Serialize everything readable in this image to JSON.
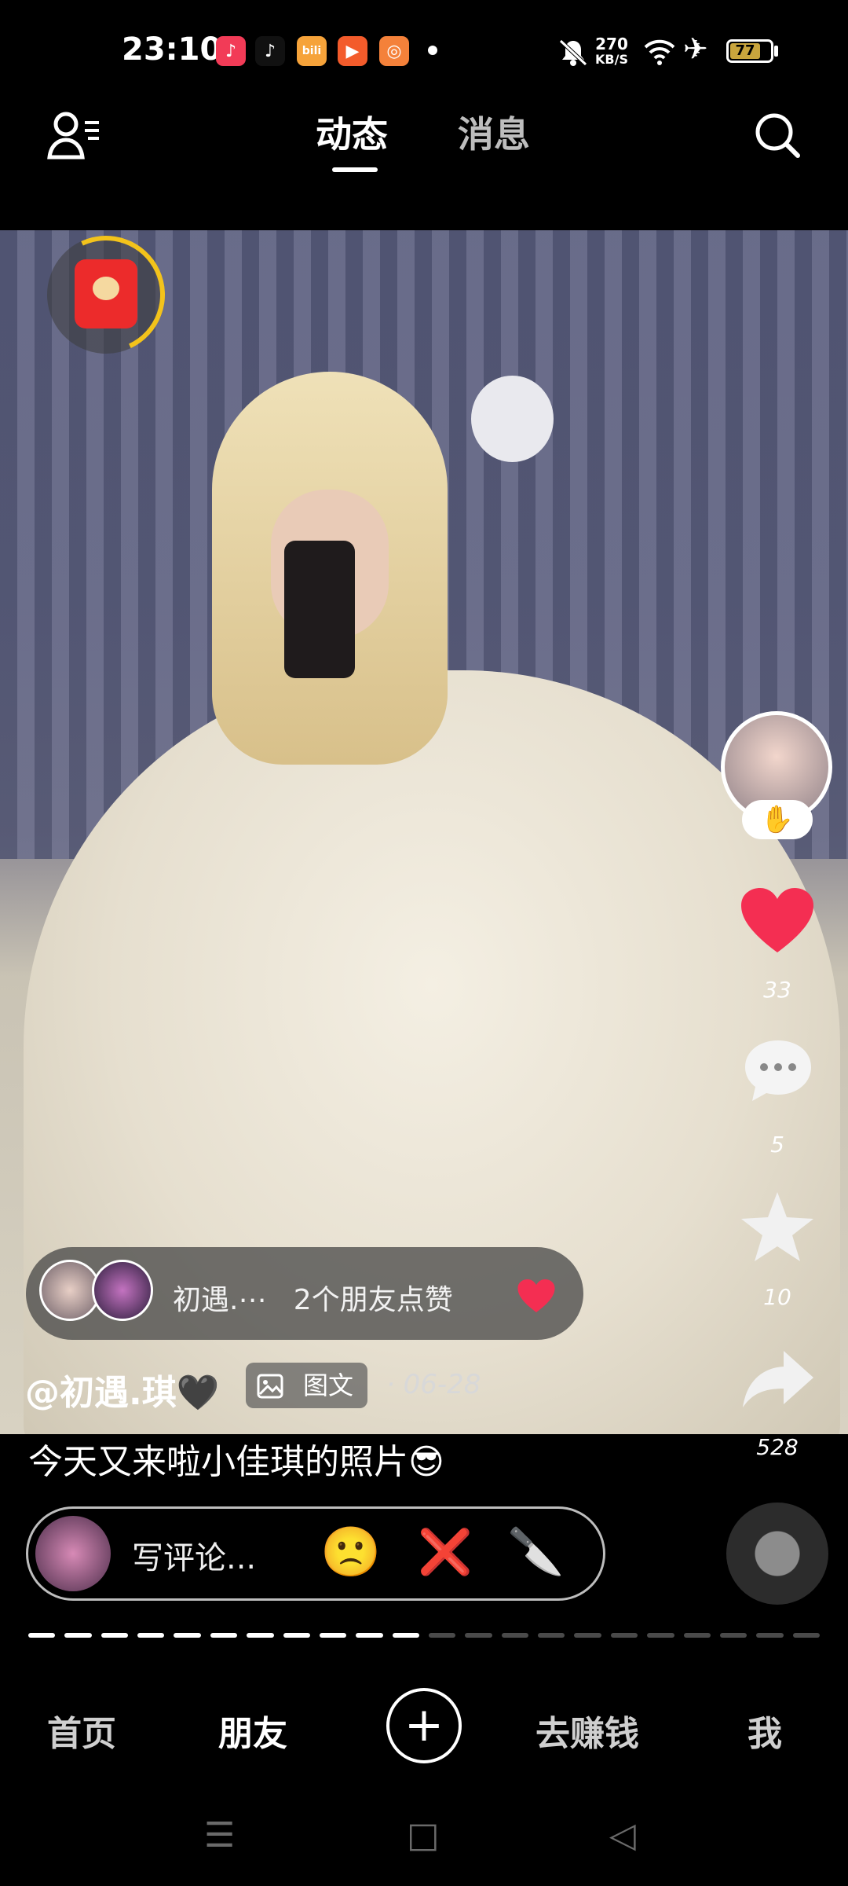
{
  "status_bar": {
    "time": "23:10",
    "net_speed_value": "270",
    "net_speed_unit": "KB/S",
    "battery": "77",
    "app_icons": [
      "music-app-icon",
      "tiktok-icon",
      "bilibili-icon",
      "video-app-icon",
      "sticker-app-icon"
    ]
  },
  "header": {
    "tabs": [
      {
        "label": "动态"
      },
      {
        "label": "消息"
      }
    ],
    "active_tab": 0
  },
  "post": {
    "like_count": "33",
    "comment_count": "5",
    "favorite_count": "10",
    "share_count": "528",
    "friend_like_name": "初遇.⋯",
    "friend_like_text": "2个朋友点赞",
    "author": "@初遇.琪🖤",
    "type_badge": "图文",
    "date": "· 06-28",
    "caption": "今天又来啦小佳琪的照片😎"
  },
  "comment_bar": {
    "placeholder": "写评论...",
    "emojis": [
      "🙁",
      "❌",
      "🔪"
    ]
  },
  "progress": {
    "total_segments": 22,
    "filled_segments": 11
  },
  "bottom_nav": [
    {
      "label": "首页"
    },
    {
      "label": "朋友"
    },
    {
      "label": "去赚钱"
    },
    {
      "label": "我"
    }
  ],
  "colors": {
    "like": "#f42e52",
    "progress_on": "#ffffff",
    "progress_off": "#4a4a4a"
  }
}
